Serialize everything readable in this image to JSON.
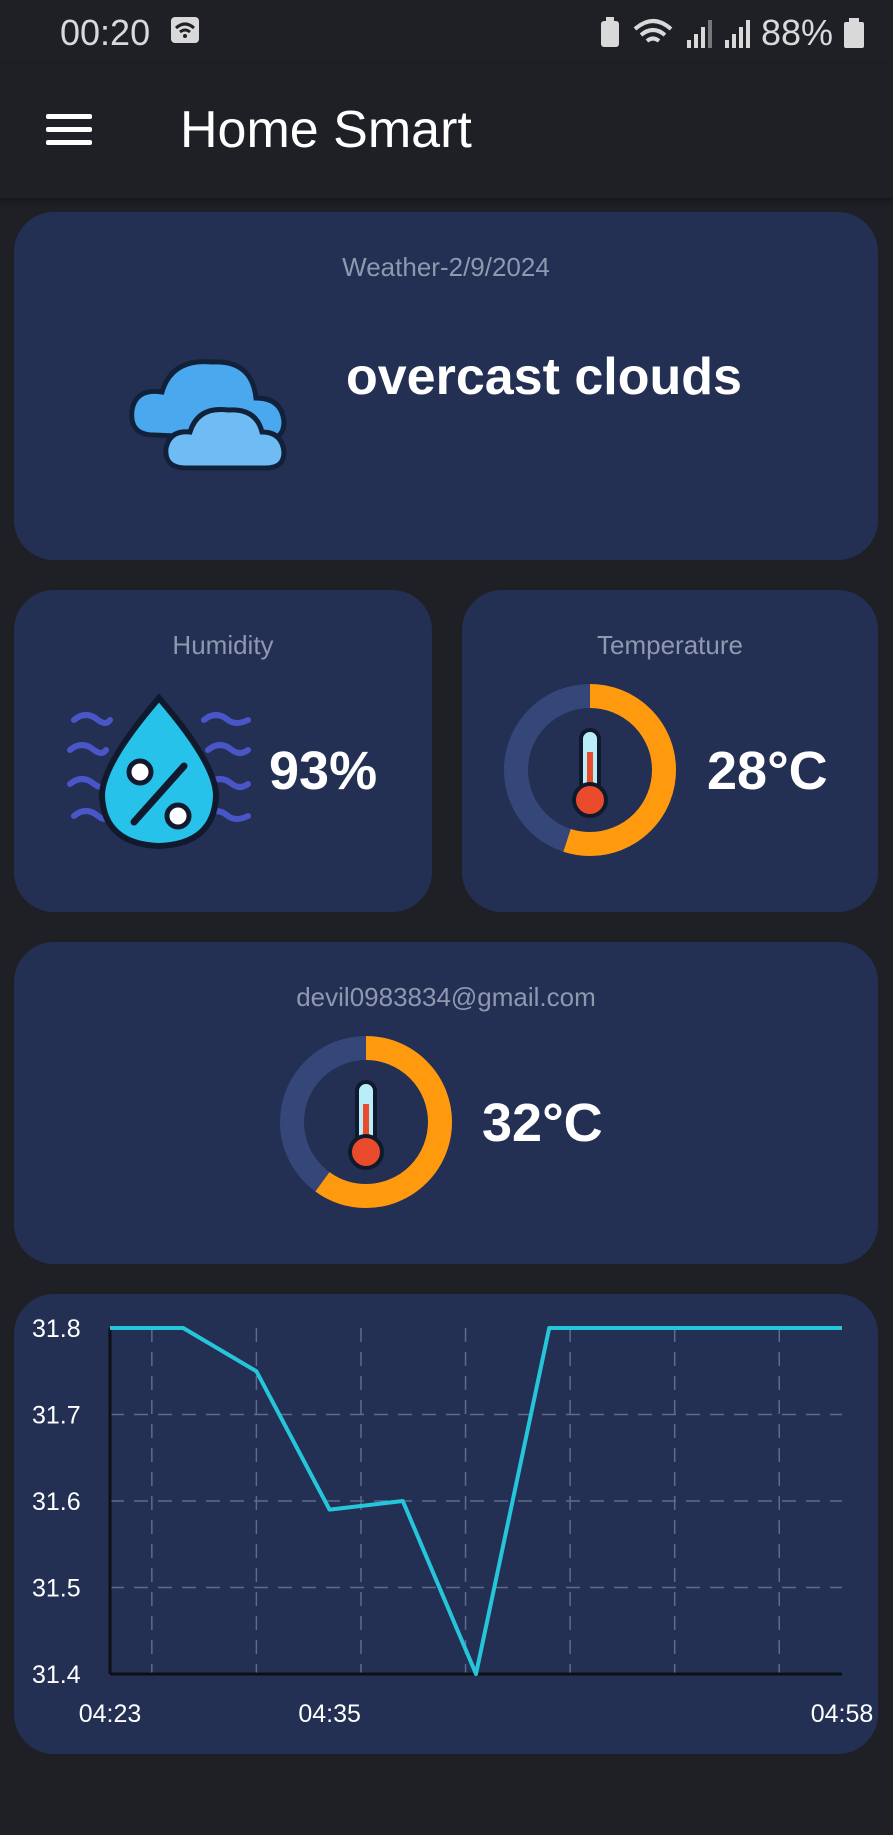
{
  "status_bar": {
    "time": "00:20",
    "battery": "88%"
  },
  "app_bar": {
    "title": "Home Smart"
  },
  "weather": {
    "caption": "Weather-2/9/2024",
    "description": "overcast clouds"
  },
  "humidity": {
    "caption": "Humidity",
    "value": "93%",
    "percent": 93
  },
  "temperature": {
    "caption": "Temperature",
    "value": "28°C",
    "gauge_fraction": 0.55
  },
  "device": {
    "email": "devil0983834@gmail.com",
    "value": "32°C",
    "gauge_fraction": 0.6
  },
  "colors": {
    "accent": "#ff9a0f",
    "line": "#26c6da",
    "card": "#233054",
    "background": "#1e2026"
  },
  "chart_data": {
    "type": "line",
    "x": [
      "04:23",
      "",
      "",
      "04:35",
      "",
      "",
      "",
      "",
      "",
      "",
      "04:58"
    ],
    "x_labels": [
      "04:23",
      "04:35",
      "04:58"
    ],
    "values": [
      31.8,
      31.8,
      31.75,
      31.59,
      31.6,
      31.4,
      31.8,
      31.8,
      31.8,
      31.8,
      31.8
    ],
    "yticks": [
      "31.8",
      "31.7",
      "31.6",
      "31.5",
      "31.4"
    ],
    "ylim": [
      31.4,
      31.8
    ],
    "grid": true
  }
}
